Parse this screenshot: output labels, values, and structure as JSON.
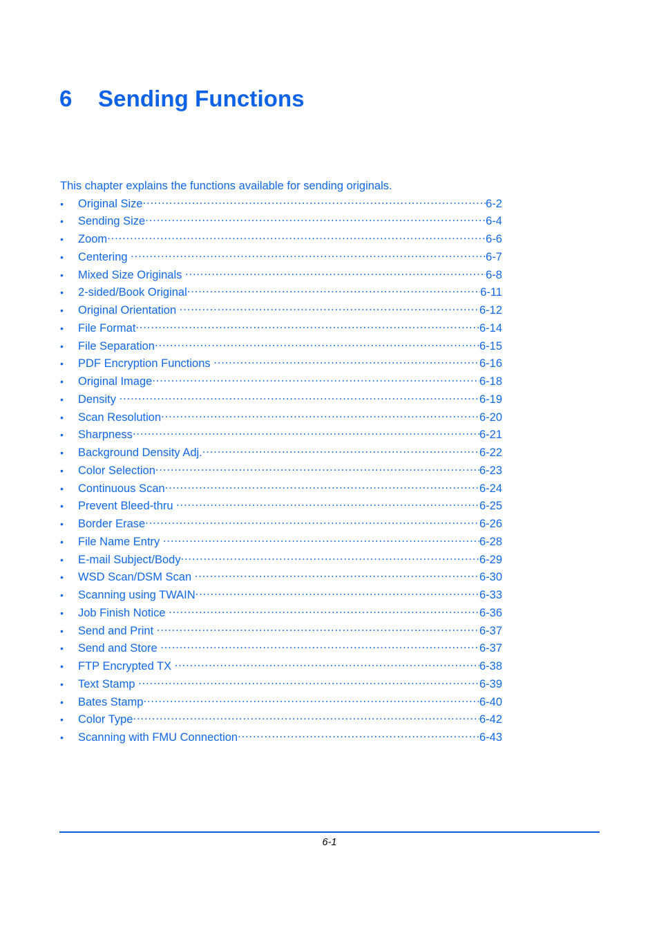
{
  "document": {
    "chapter_number": "6",
    "chapter_title": "Sending Functions",
    "intro": "This chapter explains the functions available for sending originals.",
    "bullet_glyph": "•"
  },
  "colors": {
    "heading_blue": "#0d62e8",
    "body_blue": "#1068e8",
    "rule_blue": "#0a5fd8",
    "footer_text": "#000000",
    "page_background": "#ffffff"
  },
  "toc": {
    "entries": [
      {
        "label": "Original Size",
        "page": "6-2",
        "space_before_leader": false
      },
      {
        "label": "Sending Size",
        "page": "6-4",
        "space_before_leader": false
      },
      {
        "label": "Zoom",
        "page": "6-6",
        "space_before_leader": false
      },
      {
        "label": "Centering",
        "page": "6-7",
        "space_before_leader": true
      },
      {
        "label": "Mixed Size Originals",
        "page": "6-8",
        "space_before_leader": true
      },
      {
        "label": "2-sided/Book Original",
        "page": "6-11",
        "space_before_leader": false
      },
      {
        "label": "Original Orientation",
        "page": "6-12",
        "space_before_leader": true
      },
      {
        "label": "File Format",
        "page": "6-14",
        "space_before_leader": false
      },
      {
        "label": "File Separation",
        "page": "6-15",
        "space_before_leader": false
      },
      {
        "label": "PDF Encryption Functions",
        "page": "6-16",
        "space_before_leader": true
      },
      {
        "label": "Original Image",
        "page": "6-18",
        "space_before_leader": false
      },
      {
        "label": "Density",
        "page": "6-19",
        "space_before_leader": true
      },
      {
        "label": "Scan Resolution",
        "page": "6-20",
        "space_before_leader": false
      },
      {
        "label": "Sharpness",
        "page": "6-21",
        "space_before_leader": false
      },
      {
        "label": "Background Density Adj.",
        "page": "6-22",
        "space_before_leader": false
      },
      {
        "label": "Color Selection",
        "page": "6-23",
        "space_before_leader": false
      },
      {
        "label": "Continuous Scan",
        "page": "6-24",
        "space_before_leader": false
      },
      {
        "label": "Prevent Bleed-thru",
        "page": "6-25",
        "space_before_leader": true
      },
      {
        "label": "Border Erase",
        "page": "6-26",
        "space_before_leader": false
      },
      {
        "label": "File Name Entry",
        "page": "6-28",
        "space_before_leader": true
      },
      {
        "label": "E-mail Subject/Body",
        "page": "6-29",
        "space_before_leader": false
      },
      {
        "label": "WSD Scan/DSM Scan",
        "page": "6-30",
        "space_before_leader": true
      },
      {
        "label": "Scanning using TWAIN",
        "page": "6-33",
        "space_before_leader": false
      },
      {
        "label": "Job Finish Notice",
        "page": "6-36",
        "space_before_leader": true
      },
      {
        "label": "Send and Print",
        "page": "6-37",
        "space_before_leader": true
      },
      {
        "label": "Send and Store",
        "page": "6-37",
        "space_before_leader": true
      },
      {
        "label": "FTP Encrypted TX",
        "page": "6-38",
        "space_before_leader": true
      },
      {
        "label": "Text Stamp",
        "page": "6-39",
        "space_before_leader": true
      },
      {
        "label": "Bates Stamp",
        "page": "6-40",
        "space_before_leader": false
      },
      {
        "label": "Color Type",
        "page": "6-42",
        "space_before_leader": false
      },
      {
        "label": "Scanning with FMU Connection",
        "page": "6-43",
        "space_before_leader": false
      }
    ]
  },
  "footer": {
    "page_label": "6-1"
  }
}
